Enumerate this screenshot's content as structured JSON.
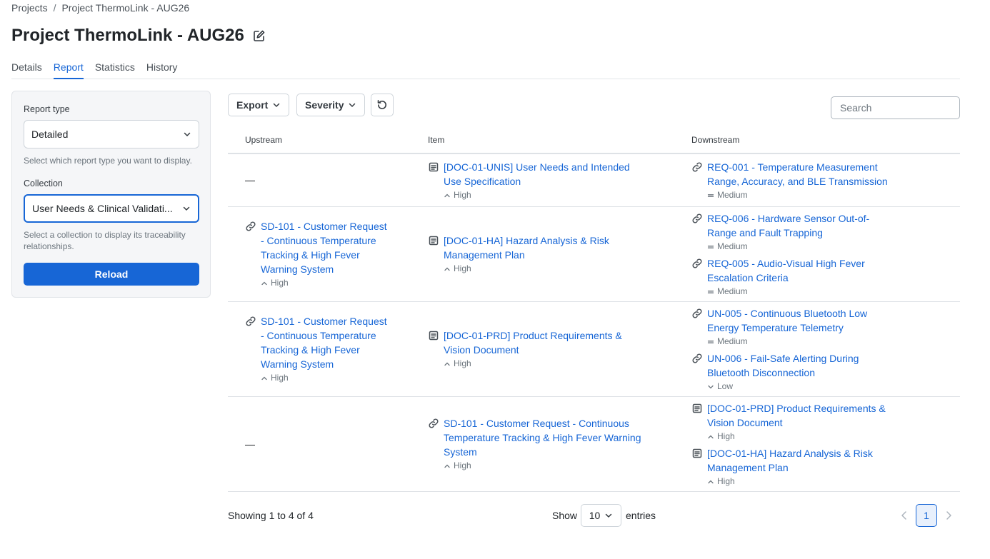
{
  "breadcrumb": {
    "root": "Projects",
    "separator": "/",
    "current": "Project ThermoLink - AUG26"
  },
  "page": {
    "title": "Project ThermoLink - AUG26"
  },
  "tabs": [
    {
      "label": "Details",
      "active": false
    },
    {
      "label": "Report",
      "active": true
    },
    {
      "label": "Statistics",
      "active": false
    },
    {
      "label": "History",
      "active": false
    }
  ],
  "sidebar": {
    "report_type_label": "Report type",
    "report_type_value": "Detailed",
    "report_type_help": "Select which report type you want to display.",
    "collection_label": "Collection",
    "collection_value": "User Needs & Clinical Validati...",
    "collection_help": "Select a collection to display its traceability relationships.",
    "reload_label": "Reload"
  },
  "toolbar": {
    "export_label": "Export",
    "severity_label": "Severity",
    "search_placeholder": "Search"
  },
  "table": {
    "headers": {
      "upstream": "Upstream",
      "item": "Item",
      "downstream": "Downstream"
    },
    "empty_marker": "—",
    "rows": [
      {
        "upstream": [],
        "item": [
          {
            "icon": "document-icon",
            "text": "[DOC-01-UNIS] User Needs and Intended Use Specification",
            "severity": "High"
          }
        ],
        "downstream": [
          {
            "icon": "link-icon",
            "text": "REQ-001 - Temperature Measurement Range, Accuracy, and BLE Transmission",
            "severity": "Medium"
          }
        ]
      },
      {
        "upstream": [
          {
            "icon": "link-icon",
            "text": "SD-101 - Customer Request - Continuous Temperature Tracking & High Fever Warning System",
            "severity": "High"
          }
        ],
        "item": [
          {
            "icon": "document-icon",
            "text": "[DOC-01-HA] Hazard Analysis & Risk Management Plan",
            "severity": "High"
          }
        ],
        "downstream": [
          {
            "icon": "link-icon",
            "text": "REQ-006 - Hardware Sensor Out-of-Range and Fault Trapping",
            "severity": "Medium"
          },
          {
            "icon": "link-icon",
            "text": "REQ-005 - Audio-Visual High Fever Escalation Criteria",
            "severity": "Medium"
          }
        ]
      },
      {
        "upstream": [
          {
            "icon": "link-icon",
            "text": "SD-101 - Customer Request - Continuous Temperature Tracking & High Fever Warning System",
            "severity": "High"
          }
        ],
        "item": [
          {
            "icon": "document-icon",
            "text": "[DOC-01-PRD] Product Requirements & Vision Document",
            "severity": "High"
          }
        ],
        "downstream": [
          {
            "icon": "link-icon",
            "text": "UN-005 - Continuous Bluetooth Low Energy Temperature Telemetry",
            "severity": "Medium"
          },
          {
            "icon": "link-icon",
            "text": "UN-006 - Fail-Safe Alerting During Bluetooth Disconnection",
            "severity": "Low"
          }
        ]
      },
      {
        "upstream": [],
        "item": [
          {
            "icon": "link-icon",
            "text": "SD-101 - Customer Request - Continuous Temperature Tracking & High Fever Warning System",
            "severity": "High"
          }
        ],
        "downstream": [
          {
            "icon": "document-icon",
            "text": "[DOC-01-PRD] Product Requirements & Vision Document",
            "severity": "High"
          },
          {
            "icon": "document-icon",
            "text": "[DOC-01-HA] Hazard Analysis & Risk Management Plan",
            "severity": "High"
          }
        ]
      }
    ]
  },
  "footer": {
    "showing": "Showing 1 to 4 of 4",
    "show_label": "Show",
    "page_size": "10",
    "entries_label": "entries",
    "current_page": "1"
  },
  "colors": {
    "accent": "#1766d6",
    "border": "#dee2e6",
    "muted": "#6c757d"
  }
}
